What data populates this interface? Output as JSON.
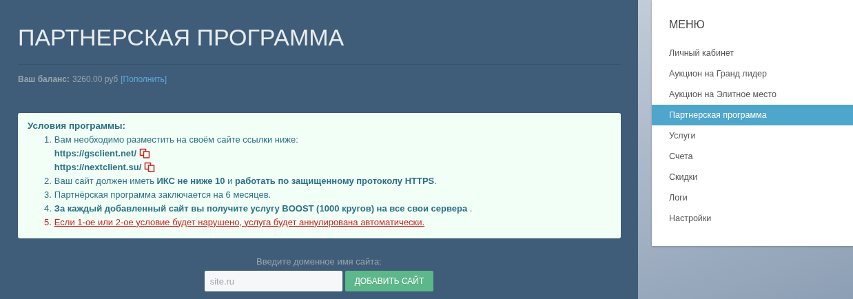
{
  "page_title": "ПАРТНЕРСКАЯ ПРОГРАММА",
  "balance": {
    "label": "Ваш баланс:",
    "amount": "3260.00 руб",
    "topup_link": "[Пополнить]"
  },
  "conditions": {
    "title": "Условия программы:",
    "items": [
      {
        "kind": "normal",
        "number": "1.",
        "text": "Вам необходимо разместить на своём сайте ссылки ниже:",
        "links": [
          "https://gsclient.net/",
          "https://nextclient.su/"
        ]
      },
      {
        "kind": "normal",
        "number": "2.",
        "text": "Ваш сайт должен иметь **ИКС не ниже 10** и **работать по защищенному протоколу HTTPS**."
      },
      {
        "kind": "normal",
        "number": "3.",
        "text": "Партнёрская программа заключается на 6 месяцев."
      },
      {
        "kind": "normal",
        "number": "4.",
        "text": "**За каждый добавленный сайт вы получите услугу BOOST (1000 кругов) на все свои сервера** ."
      },
      {
        "kind": "warning",
        "number": "5.",
        "text": "Если 1-ое или 2-ое условие будет нарушено, услуга будет аннулирована автоматически."
      }
    ]
  },
  "domain_form": {
    "label": "Введите доменное имя сайта:",
    "placeholder": "site.ru",
    "button": "ДОБАВИТЬ САЙТ"
  },
  "menu": {
    "title": "МЕНЮ",
    "items": [
      {
        "label": "Личный кабинет",
        "selected": false
      },
      {
        "label": "Аукцион на Гранд лидер",
        "selected": false
      },
      {
        "label": "Аукцион на Элитное место",
        "selected": false
      },
      {
        "label": "Партнерская программа",
        "selected": true
      },
      {
        "label": "Услуги",
        "selected": false
      },
      {
        "label": "Счета",
        "selected": false
      },
      {
        "label": "Скидки",
        "selected": false
      },
      {
        "label": "Логи",
        "selected": false
      },
      {
        "label": "Настройки",
        "selected": false
      }
    ]
  }
}
